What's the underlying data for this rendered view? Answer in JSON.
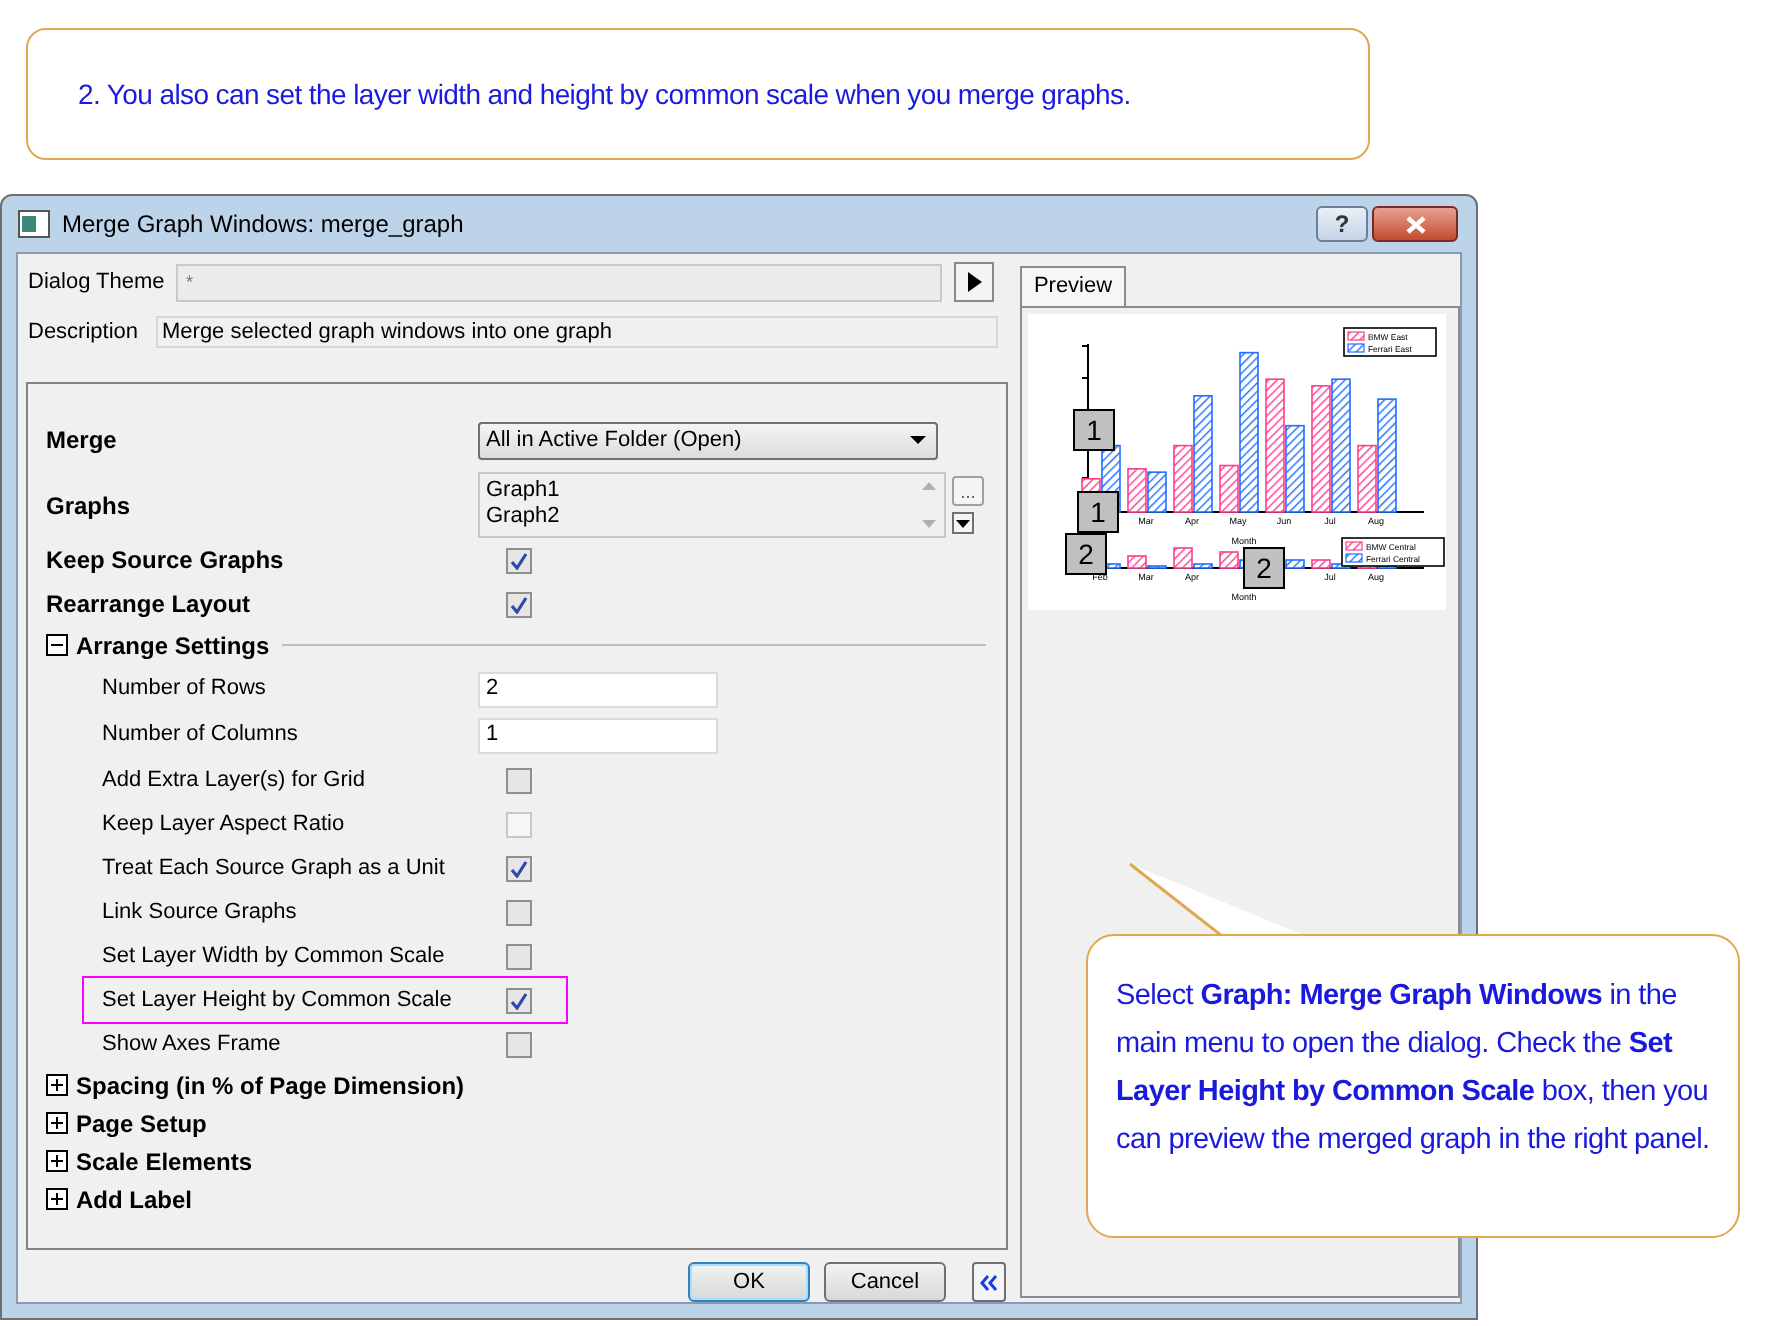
{
  "top_callout": {
    "text": "2. You also can set the layer width and height by common scale when you merge graphs."
  },
  "dialog": {
    "title": "Merge Graph Windows: merge_graph",
    "help": "?"
  },
  "theme": {
    "label": "Dialog Theme",
    "placeholder": "*"
  },
  "description": {
    "label": "Description",
    "value": "Merge selected graph windows into one graph"
  },
  "settings": [
    {
      "kind": "dropdown",
      "label": "Merge",
      "value": "All in Active Folder (Open)"
    },
    {
      "kind": "list",
      "label": "Graphs",
      "items": [
        "Graph1",
        "Graph2"
      ],
      "more": "..."
    },
    {
      "kind": "checkbox",
      "label": "Keep Source Graphs",
      "checked": true,
      "disabled": false
    },
    {
      "kind": "checkbox",
      "label": "Rearrange Layout",
      "checked": true,
      "disabled": false
    },
    {
      "kind": "group",
      "label": "Arrange Settings",
      "expanded": true,
      "children": [
        {
          "kind": "text",
          "label": "Number of Rows",
          "value": "2",
          "highlighted": false
        },
        {
          "kind": "text",
          "label": "Number of Columns",
          "value": "1",
          "highlighted": false
        },
        {
          "kind": "checkbox",
          "label": "Add Extra Layer(s) for Grid",
          "checked": false,
          "disabled": false,
          "highlighted": false
        },
        {
          "kind": "checkbox",
          "label": "Keep Layer Aspect Ratio",
          "checked": false,
          "disabled": true,
          "highlighted": false
        },
        {
          "kind": "checkbox",
          "label": "Treat Each Source Graph as a Unit",
          "checked": true,
          "disabled": false,
          "highlighted": false
        },
        {
          "kind": "checkbox",
          "label": "Link Source Graphs",
          "checked": false,
          "disabled": false,
          "highlighted": false
        },
        {
          "kind": "checkbox",
          "label": "Set Layer Width by Common Scale",
          "checked": false,
          "disabled": false,
          "highlighted": false
        },
        {
          "kind": "checkbox",
          "label": "Set Layer Height by Common Scale",
          "checked": true,
          "disabled": false,
          "highlighted": true
        },
        {
          "kind": "checkbox",
          "label": "Show Axes Frame",
          "checked": false,
          "disabled": false,
          "highlighted": false
        }
      ]
    },
    {
      "kind": "group",
      "label": "Spacing (in % of Page Dimension)",
      "expanded": false
    },
    {
      "kind": "group",
      "label": "Page Setup",
      "expanded": false
    },
    {
      "kind": "group",
      "label": "Scale Elements",
      "expanded": false
    },
    {
      "kind": "group",
      "label": "Add Label",
      "expanded": false
    }
  ],
  "preview": {
    "tab": "Preview",
    "selected": true,
    "layers": [
      {
        "legend": [
          "BMW East",
          "Ferrari East"
        ],
        "month_groups": [
          [
            "Mar",
            "Apr",
            "May",
            "Jun",
            "Jul",
            "Aug"
          ]
        ],
        "xlabel": "Month"
      },
      {
        "legend": [
          "BMW Central",
          "Ferrari Central"
        ],
        "month_groups": [
          [
            "Feb",
            "Mar",
            "Apr"
          ],
          [
            "Jul",
            "Aug"
          ]
        ],
        "xlabel": "Month"
      }
    ],
    "badges": [
      "1",
      "1",
      "2",
      "2"
    ]
  },
  "buttons": [
    "OK",
    "Cancel"
  ],
  "callout": {
    "text": "Select **Graph: Merge Graph Windows** in the main menu to open the dialog. Check the **Set Layer Height by Common Scale** box, then you can preview the merged graph in the right panel."
  }
}
